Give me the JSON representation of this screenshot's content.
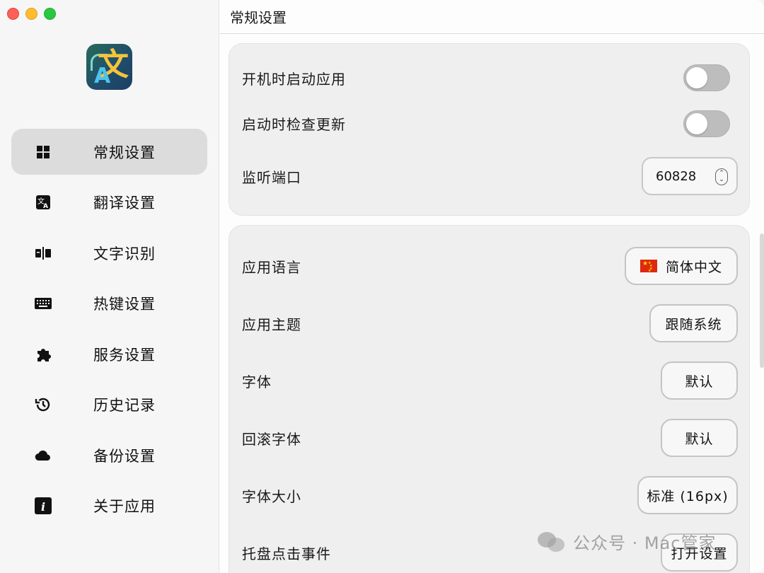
{
  "window": {
    "title": "常规设置"
  },
  "sidebar": {
    "items": [
      {
        "label": "常规设置",
        "icon": "grid-icon",
        "active": true
      },
      {
        "label": "翻译设置",
        "icon": "translate-icon",
        "active": false
      },
      {
        "label": "文字识别",
        "icon": "ocr-icon",
        "active": false
      },
      {
        "label": "热键设置",
        "icon": "keyboard-icon",
        "active": false
      },
      {
        "label": "服务设置",
        "icon": "puzzle-icon",
        "active": false
      },
      {
        "label": "历史记录",
        "icon": "history-icon",
        "active": false
      },
      {
        "label": "备份设置",
        "icon": "cloud-icon",
        "active": false
      },
      {
        "label": "关于应用",
        "icon": "info-icon",
        "active": false
      }
    ]
  },
  "main": {
    "header": "常规设置",
    "card1": {
      "launch_at_login": {
        "label": "开机时启动应用",
        "on": false
      },
      "check_update": {
        "label": "启动时检查更新",
        "on": false
      },
      "port": {
        "label": "监听端口",
        "value": "60828"
      }
    },
    "card2": {
      "language": {
        "label": "应用语言",
        "value": "简体中文",
        "flag": "cn-flag"
      },
      "theme": {
        "label": "应用主题",
        "value": "跟随系统"
      },
      "font": {
        "label": "字体",
        "value": "默认"
      },
      "fallback_font": {
        "label": "回滚字体",
        "value": "默认"
      },
      "font_size": {
        "label": "字体大小",
        "value": "标准 (16px)"
      },
      "tray_click": {
        "label": "托盘点击事件",
        "value": "打开设置"
      }
    }
  },
  "watermark": {
    "text": "公众号 · Mac管家"
  },
  "colors": {
    "accent": "#dcdcdc",
    "toggle_off": "#bdbdbd",
    "close": "#fe5f57",
    "minimize": "#febc2e",
    "zoom": "#28c840"
  }
}
